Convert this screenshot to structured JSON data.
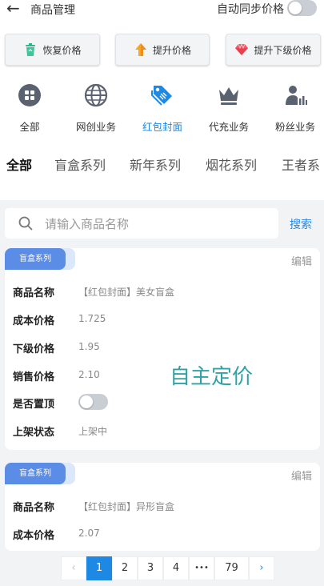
{
  "header": {
    "title": "商品管理",
    "sync_label": "自动同步价格",
    "back_icon": "←"
  },
  "actions": [
    {
      "label": "恢复价格",
      "icon": "trash-can-icon"
    },
    {
      "label": "提升价格",
      "icon": "arrow-up-icon"
    },
    {
      "label": "提升下级价格",
      "icon": "diamond-icon"
    }
  ],
  "categories": [
    {
      "label": "全部",
      "icon": "grid-icon"
    },
    {
      "label": "网创业务",
      "icon": "globe-icon"
    },
    {
      "label": "红包封面",
      "icon": "tag-icon"
    },
    {
      "label": "代充业务",
      "icon": "crown-icon"
    },
    {
      "label": "粉丝业务",
      "icon": "person-chart-icon"
    }
  ],
  "active_category": "红包封面",
  "tabs": [
    "全部",
    "盲盒系列",
    "新年系列",
    "烟花系列",
    "王者系"
  ],
  "active_tab": "全部",
  "search": {
    "placeholder": "请输入商品名称",
    "button": "搜索"
  },
  "products": [
    {
      "tag": "盲盒系列",
      "edit": "编辑",
      "rows": [
        {
          "label": "商品名称",
          "value": "【红包封面】美女盲盒"
        },
        {
          "label": "成本价格",
          "value": "1.725"
        },
        {
          "label": "下级价格",
          "value": "1.95"
        },
        {
          "label": "销售价格",
          "value": "2.10"
        },
        {
          "label": "是否置顶",
          "value": ""
        },
        {
          "label": "上架状态",
          "value": "上架中"
        }
      ],
      "pinned": false
    },
    {
      "tag": "盲盒系列",
      "edit": "编辑",
      "rows": [
        {
          "label": "商品名称",
          "value": "【红包封面】异形盲盒"
        },
        {
          "label": "成本价格",
          "value": "2.07"
        }
      ]
    }
  ],
  "overlay_text": "自主定价",
  "pagination": {
    "prev": "‹",
    "pages": [
      "1",
      "2",
      "3",
      "4"
    ],
    "ellipsis": "•••",
    "last": "79",
    "next": "›",
    "current": "1"
  },
  "colors": {
    "accent": "#1e88e5",
    "tag": "#5b8de6",
    "overlay": "#2ea3a5"
  }
}
